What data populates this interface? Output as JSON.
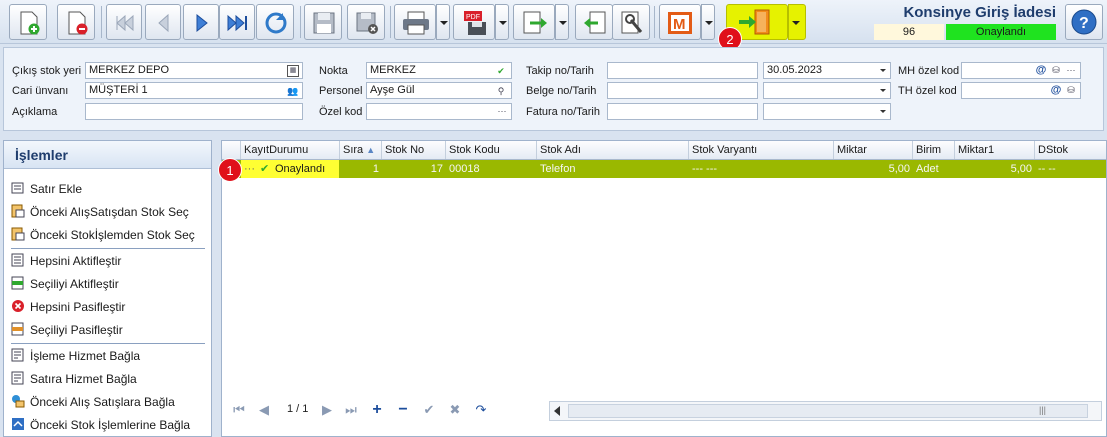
{
  "document": {
    "title": "Konsinye Giriş İadesi",
    "number": "96",
    "status": "Onaylandı"
  },
  "markers": [
    "1",
    "2"
  ],
  "form": {
    "cikis_stok_yeri_label": "Çıkış stok yeri",
    "cikis_stok_yeri_value": "MERKEZ DEPO",
    "cari_unvani_label": "Cari ünvanı",
    "cari_unvani_value": "MÜŞTERİ 1",
    "aciklama_label": "Açıklama",
    "aciklama_value": "",
    "nokta_label": "Nokta",
    "nokta_value": "MERKEZ",
    "personel_label": "Personel",
    "personel_value": "Ayşe Gül",
    "ozel_kod_label": "Özel kod",
    "ozel_kod_value": "",
    "takip_label": "Takip no/Tarih",
    "takip_value": "",
    "takip_date": "30.05.2023",
    "belge_label": "Belge no/Tarih",
    "belge_value": "",
    "belge_date": "",
    "fatura_label": "Fatura no/Tarih",
    "fatura_value": "",
    "fatura_date": "",
    "mh_label": "MH özel kod",
    "mh_value": "",
    "th_label": "TH özel kod",
    "th_value": "",
    "at_symbol": "@",
    "dots": "···"
  },
  "left_panel": {
    "title": "İşlemler",
    "actions": [
      "Satır Ekle",
      "Önceki AlışSatışdan Stok Seç",
      "Önceki Stokİşlemden Stok Seç",
      "Hepsini Aktifleştir",
      "Seçiliyi Aktifleştir",
      "Hepsini Pasifleştir",
      "Seçiliyi Pasifleştir",
      "İşleme Hizmet Bağla",
      "Satıra Hizmet Bağla",
      "Önceki Alış Satışlara Bağla",
      "Önceki Stok İşlemlerine Bağla"
    ]
  },
  "grid": {
    "columns": [
      "KayıtDurumu",
      "Sıra",
      "Stok No",
      "Stok Kodu",
      "Stok Adı",
      "Stok Varyantı",
      "Miktar",
      "Birim",
      "Miktar1",
      "DStok"
    ],
    "row": {
      "kayit_durumu": "Onaylandı",
      "dots": "···",
      "sira": "1",
      "stok_no": "17",
      "stok_kodu": "00018",
      "stok_adi": "Telefon",
      "stok_varyanti": "--- ---",
      "miktar": "5,00",
      "birim": "Adet",
      "miktar1": "5,00",
      "dstok": "-- --"
    },
    "pager": "1 / 1",
    "scroll_grip": "|||"
  },
  "colors": {
    "row_highlight": "#9ab800",
    "status_cell": "#ffff33",
    "status_badge": "#1fe31f",
    "marker": "#e0101a"
  },
  "icons": [
    "new-doc-icon",
    "delete-doc-icon",
    "first-icon",
    "prev-icon",
    "next-icon",
    "last-icon",
    "refresh-icon",
    "save-icon",
    "save-close-icon",
    "print-icon",
    "pdf-icon",
    "export-icon",
    "import-icon",
    "tools-icon",
    "m-icon",
    "exit-door-icon",
    "help-icon"
  ]
}
